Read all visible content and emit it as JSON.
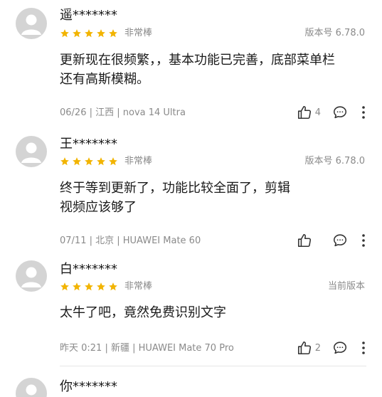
{
  "colors": {
    "star": "#f2b400",
    "avatar_bg": "#d4d4d4",
    "secondary_text": "#8a8a8a"
  },
  "icons": {
    "avatar": "person-silhouette-icon",
    "star": "star-icon",
    "like": "thumbs-up-icon",
    "comment": "comment-bubble-icon",
    "more": "more-vertical-icon"
  },
  "reviews": [
    {
      "username": "遥*******",
      "stars": 5,
      "rating_label": "非常棒",
      "version": "版本号 6.78.0",
      "content_lines": [
        "更新现在很频繁，，基本功能已完善，底部菜单栏",
        "还有高斯模糊。"
      ],
      "meta": "06/26 | 江西 | nova 14 Ultra",
      "likes": "4"
    },
    {
      "username": "王*******",
      "stars": 5,
      "rating_label": "非常棒",
      "version": "版本号 6.78.0",
      "content_lines": [
        "终于等到更新了，功能比较全面了，剪辑",
        "视频应该够了"
      ],
      "meta": "07/11 | 北京 | HUAWEI Mate 60",
      "likes": ""
    },
    {
      "username": "白*******",
      "stars": 5,
      "rating_label": "非常棒",
      "version": "当前版本",
      "content_lines": [
        "太牛了吧，竟然免费识别文字"
      ],
      "meta": "昨天 0:21 | 新疆 | HUAWEI Mate 70 Pro",
      "likes": "2"
    },
    {
      "username": "你*******"
    }
  ]
}
